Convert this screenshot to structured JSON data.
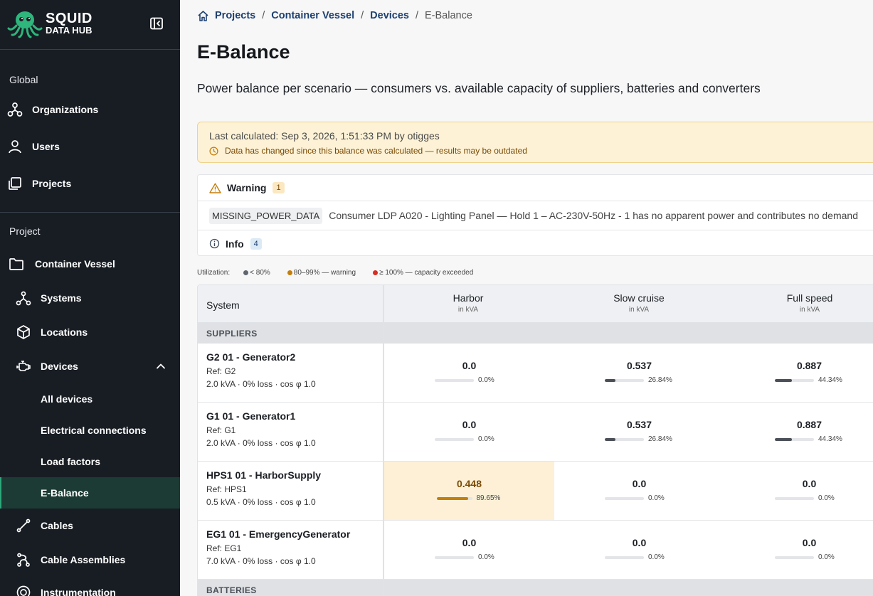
{
  "app": {
    "logo_line1": "SQUID",
    "logo_line2": "DATA HUB"
  },
  "sidebar": {
    "global_label": "Global",
    "project_label": "Project",
    "global_items": [
      {
        "label": "Organizations",
        "icon": "organizations-icon"
      },
      {
        "label": "Users",
        "icon": "user-icon"
      },
      {
        "label": "Projects",
        "icon": "projects-icon"
      }
    ],
    "project_name": "Container Vessel",
    "project_items": [
      {
        "label": "Systems",
        "icon": "systems-icon"
      },
      {
        "label": "Locations",
        "icon": "cube-icon"
      },
      {
        "label": "Devices",
        "icon": "engine-icon",
        "expanded": true
      }
    ],
    "device_subitems": [
      {
        "label": "All devices"
      },
      {
        "label": "Electrical connections"
      },
      {
        "label": "Load factors"
      },
      {
        "label": "E-Balance",
        "active": true
      }
    ],
    "more_items": [
      {
        "label": "Cables",
        "icon": "cable-icon"
      },
      {
        "label": "Cable Assemblies",
        "icon": "cable-assembly-icon"
      },
      {
        "label": "Instrumentation",
        "icon": "instrumentation-icon"
      }
    ]
  },
  "breadcrumb": {
    "items": [
      "Projects",
      "Container Vessel",
      "Devices"
    ],
    "current": "E-Balance"
  },
  "page": {
    "title": "E-Balance",
    "subtitle": "Power balance per scenario — consumers vs. available capacity of suppliers, batteries and converters"
  },
  "alert": {
    "last_calculated": "Last calculated: Sep 3, 2026, 1:51:33 PM by otigges",
    "outdated": "Data has changed since this balance was calculated — results may be outdated"
  },
  "messages": {
    "warning_label": "Warning",
    "warning_count": "1",
    "warning_code": "MISSING_POWER_DATA",
    "warning_text": "Consumer LDP A020 - Lighting Panel — Hold 1 – AC-230V-50Hz - 1 has no apparent power and contributes no demand",
    "info_label": "Info",
    "info_count": "4"
  },
  "legend": {
    "label": "Utilization:",
    "items": [
      {
        "text": "< 80%",
        "color": "#5f6670"
      },
      {
        "text": "80–99% — warning",
        "color": "#c47e0a"
      },
      {
        "text": "≥ 100% — capacity exceeded",
        "color": "#d92d20"
      }
    ]
  },
  "table": {
    "system_header": "System",
    "columns": [
      {
        "name": "Harbor",
        "unit": "in kVA"
      },
      {
        "name": "Slow cruise",
        "unit": "in kVA"
      },
      {
        "name": "Full speed",
        "unit": "in kVA"
      }
    ],
    "groups": [
      "SUPPLIERS",
      "BATTERIES"
    ],
    "rows": [
      {
        "name": "G2 01 - Generator2",
        "ref": "Ref: G2",
        "spec": "2.0 kVA · 0% loss · cos φ 1.0",
        "cells": [
          {
            "value": "0.0",
            "pct": "0.0%",
            "util": 0.0
          },
          {
            "value": "0.537",
            "pct": "26.84%",
            "util": 0.2684
          },
          {
            "value": "0.887",
            "pct": "44.34%",
            "util": 0.4434
          }
        ]
      },
      {
        "name": "G1 01 - Generator1",
        "ref": "Ref: G1",
        "spec": "2.0 kVA · 0% loss · cos φ 1.0",
        "cells": [
          {
            "value": "0.0",
            "pct": "0.0%",
            "util": 0.0
          },
          {
            "value": "0.537",
            "pct": "26.84%",
            "util": 0.2684
          },
          {
            "value": "0.887",
            "pct": "44.34%",
            "util": 0.4434
          }
        ]
      },
      {
        "name": "HPS1 01 - HarborSupply",
        "ref": "Ref: HPS1",
        "spec": "0.5 kVA · 0% loss · cos φ 1.0",
        "cells": [
          {
            "value": "0.448",
            "pct": "89.65%",
            "util": 0.8965,
            "warning": true
          },
          {
            "value": "0.0",
            "pct": "0.0%",
            "util": 0.0
          },
          {
            "value": "0.0",
            "pct": "0.0%",
            "util": 0.0
          }
        ]
      },
      {
        "name": "EG1 01 - EmergencyGenerator",
        "ref": "Ref: EG1",
        "spec": "7.0 kVA · 0% loss · cos φ 1.0",
        "cells": [
          {
            "value": "0.0",
            "pct": "0.0%",
            "util": 0.0
          },
          {
            "value": "0.0",
            "pct": "0.0%",
            "util": 0.0
          },
          {
            "value": "0.0",
            "pct": "0.0%",
            "util": 0.0
          }
        ]
      }
    ]
  }
}
